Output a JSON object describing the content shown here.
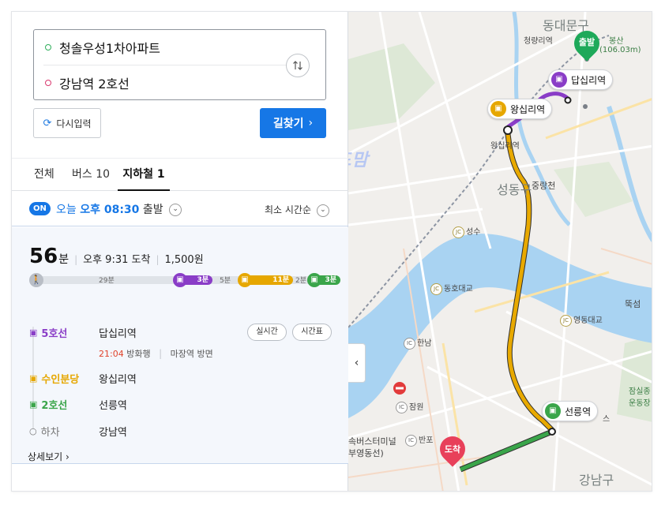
{
  "search": {
    "origin": "청솔우성1차아파트",
    "destination": "강남역 2호선",
    "reset_label": "다시입력",
    "find_label": "길찾기"
  },
  "tabs": [
    {
      "label": "전체"
    },
    {
      "label": "버스 10"
    },
    {
      "label": "지하철 1"
    }
  ],
  "departure": {
    "badge": "ON",
    "today": "오늘",
    "time": "오후 08:30",
    "suffix": "출발",
    "sort": "최소 시간순"
  },
  "result": {
    "minutes": "56",
    "minutes_unit": "분",
    "arrival": "오후 9:31 도착",
    "fare": "1,500원",
    "bar": {
      "walk": "29분",
      "line5": "3분",
      "wait": "5분",
      "suin": "11분",
      "wait2": "2분",
      "line2": "3분"
    },
    "steps": [
      {
        "line": "5호선",
        "station": "답십리역"
      },
      {
        "line": "수인분당",
        "station": "왕십리역"
      },
      {
        "line": "2호선",
        "station": "선릉역"
      },
      {
        "line": "하차",
        "station": "강남역"
      }
    ],
    "realtime_time": "21:04",
    "realtime_dir": "방화행",
    "realtime_side": "마장역 방면",
    "btn_realtime": "실시간",
    "btn_timetable": "시간표",
    "more": "상세보기"
  },
  "map": {
    "labels": {
      "dongdaemun": "동대문구",
      "cheongnyangni": "청량리역",
      "bongsan": "봉산",
      "bongsan_h": "(106.03m)",
      "wangsimni_st": "왕십리역",
      "seongdong": "성동구",
      "seongdongro": "중랑천",
      "seongsu": "성수",
      "dongho": "동호대교",
      "yeongdong": "영동대교",
      "ttukseom": "뚝섬",
      "hannam": "한남",
      "jamwon": "잠원",
      "banpo": "반포",
      "bus_terminal": "속버스터미널",
      "bus_terminal2": "부영동선)",
      "jamsil": "잠실종",
      "jamsil2": "운동장",
      "gangnam": "강남구",
      "s_tail": "스",
      "watermark": "리드맘"
    },
    "markers": {
      "start": "출발",
      "end": "도착",
      "dapsimni": "답십리역",
      "wangsimni": "왕십리역",
      "seolleung": "선릉역"
    },
    "jc": "JC",
    "ic": "IC"
  },
  "colors": {
    "accent": "#1677e6",
    "line5": "#8a3dc7",
    "suin": "#e6a700",
    "line2": "#3aa54a",
    "walk": "#b9bec6"
  }
}
